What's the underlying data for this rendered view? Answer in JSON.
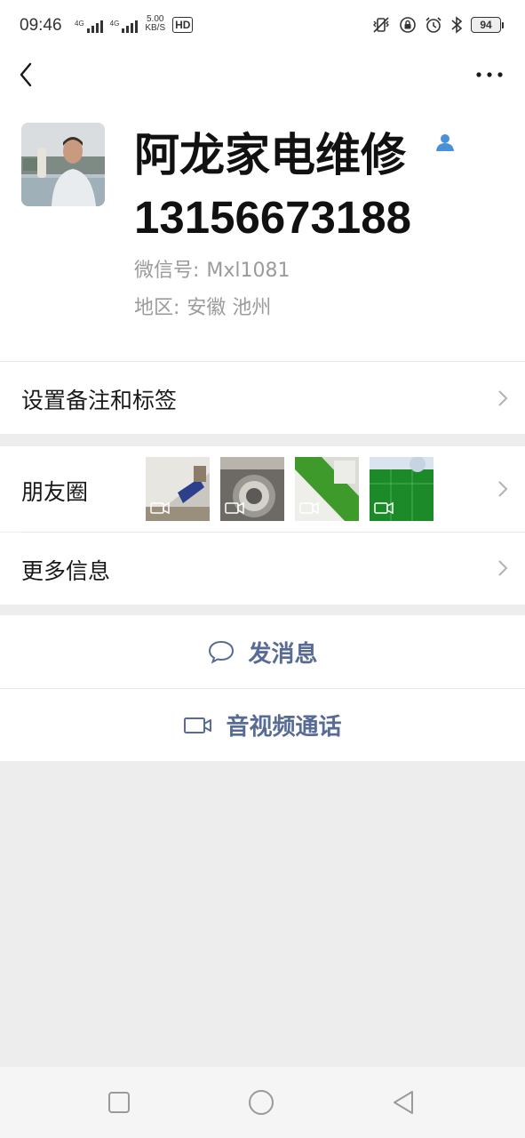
{
  "status_bar": {
    "time": "09:46",
    "signal1_label": "4G",
    "signal2_label": "4G",
    "speed_value": "5.00",
    "speed_unit": "KB/S",
    "hd_label": "HD",
    "battery": "94"
  },
  "profile": {
    "name": "阿龙家电维修",
    "phone": "13156673188",
    "wechat_id_label": "微信号:",
    "wechat_id": "Mxl1081",
    "region_label": "地区:",
    "region": "安徽  池州"
  },
  "menu": {
    "remark_tags": "设置备注和标签",
    "moments": "朋友圈",
    "more_info": "更多信息"
  },
  "moments_thumbs": [
    {
      "icon": "video-icon"
    },
    {
      "icon": "video-icon"
    },
    {
      "icon": "video-icon"
    },
    {
      "icon": "video-icon"
    }
  ],
  "actions": {
    "send_message": "发消息",
    "video_call": "音视频通话"
  },
  "colors": {
    "link": "#576b95",
    "background": "#ededed",
    "badge_blue": "#4a90d9"
  }
}
